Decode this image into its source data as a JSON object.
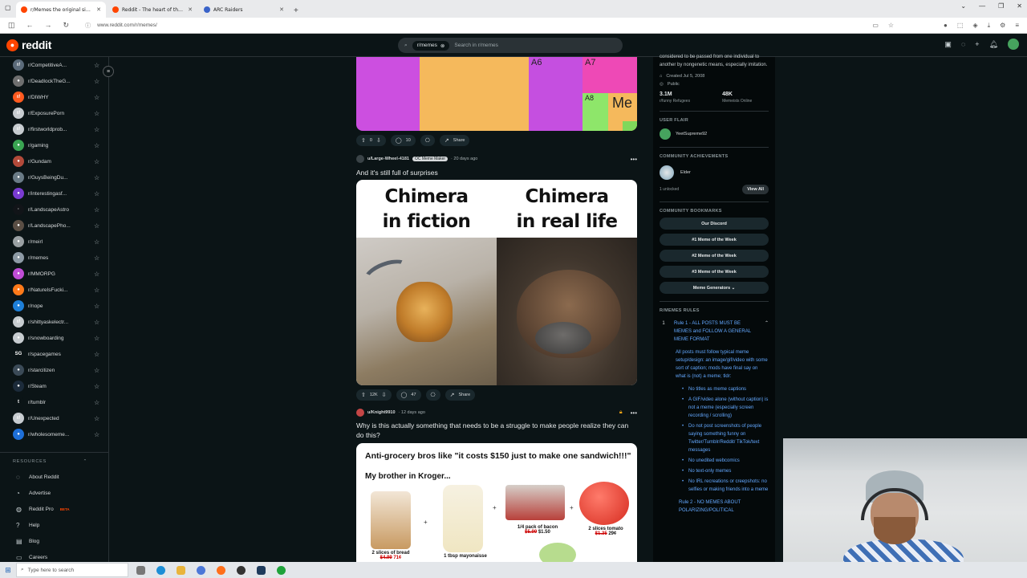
{
  "browser": {
    "tabs": [
      {
        "title": "r/Memes the original since 20..."
      },
      {
        "title": "Reddit - The heart of the intern..."
      },
      {
        "title": "ARC Raiders"
      }
    ],
    "url": "www.reddit.com/r/memes/"
  },
  "header": {
    "logo_text": "reddit",
    "search_chip": "r/memes",
    "search_placeholder": "Search in r/memes"
  },
  "sidebar": {
    "communities": [
      {
        "name": "r/CompetitiveA...",
        "color": "#5b6b7a",
        "glyph": "r/"
      },
      {
        "name": "r/DeadlockTheG...",
        "color": "#6f6f6f",
        "glyph": "●"
      },
      {
        "name": "r/DIWHY",
        "color": "#ff5a1f",
        "glyph": "r/"
      },
      {
        "name": "r/ExposurePorn",
        "color": "#c7ccd0",
        "glyph": "r/"
      },
      {
        "name": "r/firstworldprob...",
        "color": "#c7ccd0",
        "glyph": "r/"
      },
      {
        "name": "r/gaming",
        "color": "#3aa552",
        "glyph": "●"
      },
      {
        "name": "r/Gundam",
        "color": "#b34a3a",
        "glyph": "●"
      },
      {
        "name": "r/GuysBeingDu...",
        "color": "#6a7b86",
        "glyph": "●"
      },
      {
        "name": "r/interestingasf...",
        "color": "#7a3bd1",
        "glyph": "●"
      },
      {
        "name": "r/LandscapeAstro",
        "color": "#111418",
        "glyph": "·"
      },
      {
        "name": "r/LandscapePho...",
        "color": "#5a4e44",
        "glyph": "●"
      },
      {
        "name": "r/meirl",
        "color": "#9aa0a3",
        "glyph": "●"
      },
      {
        "name": "r/memes",
        "color": "#8d9aa5",
        "glyph": "●"
      },
      {
        "name": "r/MMORPG",
        "color": "#c04dd6",
        "glyph": "●"
      },
      {
        "name": "r/NatureIsFucki...",
        "color": "#ff7a1a",
        "glyph": "●"
      },
      {
        "name": "r/nope",
        "color": "#1e7fd8",
        "glyph": "●"
      },
      {
        "name": "r/shittyaskelectr...",
        "color": "#c7ccd0",
        "glyph": "r/"
      },
      {
        "name": "r/snowboarding",
        "color": "#c7ccd0",
        "glyph": "●"
      },
      {
        "name": "r/spacegames",
        "color": "#0b1416",
        "glyph": "SG"
      },
      {
        "name": "r/starcitizen",
        "color": "#3b4a57",
        "glyph": "●"
      },
      {
        "name": "r/Steam",
        "color": "#1c2b3a",
        "glyph": "●"
      },
      {
        "name": "r/tumblr",
        "color": "#0b1416",
        "glyph": "t"
      },
      {
        "name": "r/Unexpected",
        "color": "#c7ccd0",
        "glyph": "r/"
      },
      {
        "name": "r/wholesomeme...",
        "color": "#1e6fd8",
        "glyph": "●"
      }
    ],
    "resources_label": "RESOURCES",
    "resources": [
      {
        "label": "About Reddit",
        "icon": "◌"
      },
      {
        "label": "Advertise",
        "icon": "◔"
      },
      {
        "label": "Reddit Pro",
        "icon": "◍",
        "badge": "BETA"
      },
      {
        "label": "Help",
        "icon": "?"
      },
      {
        "label": "Blog",
        "icon": "▤"
      },
      {
        "label": "Careers",
        "icon": "▭"
      }
    ]
  },
  "top_meme": {
    "labels": [
      "A6",
      "A7",
      "A8",
      "Me"
    ]
  },
  "post1_actions": {
    "votes": "0",
    "comments": "10",
    "share": "Share"
  },
  "post2": {
    "user": "u/Large-Wheel-4181",
    "flair": "OC Meme Maker",
    "time": "· 20 days ago",
    "title": "And it's still full of surprises",
    "caption_left_1": "Chimera",
    "caption_left_2": "in fiction",
    "caption_right_1": "Chimera",
    "caption_right_2": "in real life",
    "votes": "12K",
    "comments": "47",
    "share": "Share"
  },
  "post3": {
    "user": "u/Knight9910",
    "time": "· 12 days ago",
    "title": "Why is this actually something that needs to be a struggle to make people realize they can do this?",
    "line1": "Anti-grocery bros like \"it costs $150 just to make one sandwich!!!\"",
    "line2": "My brother in Kroger...",
    "items": [
      {
        "label": "2 slices of bread",
        "old": "$4.99",
        "new": "71¢"
      },
      {
        "label": "1 tbsp mayonaisse",
        "old": "",
        "new": ""
      },
      {
        "label": "1/4 pack of bacon",
        "old": "$5.99",
        "new": "$1.50"
      },
      {
        "label": "2 slices tomato",
        "old": "$1.35",
        "new": "29¢"
      }
    ]
  },
  "right": {
    "desc": "considered to be passed from one individual to another by nongenetic means, especially imitation.",
    "created": "Created Jul 5, 2008",
    "visibility": "Public",
    "stat1_value": "3.1M",
    "stat1_label": "r/funny Refugees",
    "stat2_value": "48K",
    "stat2_label": "Memeists Online",
    "user_flair_heading": "USER FLAIR",
    "user_flair_name": "YeetSupreme92",
    "achievements_heading": "COMMUNITY ACHIEVEMENTS",
    "achievement": "Elder",
    "unlocked": "1 unlocked",
    "view_all": "View All",
    "bookmarks_heading": "COMMUNITY BOOKMARKS",
    "bookmarks": [
      "Our Discord",
      "#1 Meme of the Week",
      "#2 Meme of the Week",
      "#3 Meme of the Week",
      "Meme Generators ⌄"
    ],
    "rules_heading": "R/MEMES RULES",
    "rule1_num": "1",
    "rule1_title": "Rule 1 - ALL POSTS MUST BE MEMES and FOLLOW A GENERAL MEME FORMAT",
    "rule1_body": "All posts must follow typical meme setup/design: an image/gif/video with some sort of caption; mods have final say on what is (not) a meme; tldr:",
    "rule1_points": [
      "No titles as meme captions",
      "A GIF/video alone (without caption) is not a meme (especially screen recording / scrolling)",
      "Do not post screenshots of people saying something funny on Twitter/Tumblr/Reddit/ TikTok/text messages",
      "No unedited webcomics",
      "No text-only memes",
      "No IRL recreations or creepshots: no selfies or making friends into a meme"
    ],
    "rule2_title": "Rule 2 - NO MEMES ABOUT POLARIZING/POLITICAL"
  },
  "taskbar": {
    "search_placeholder": "Type here to search"
  }
}
